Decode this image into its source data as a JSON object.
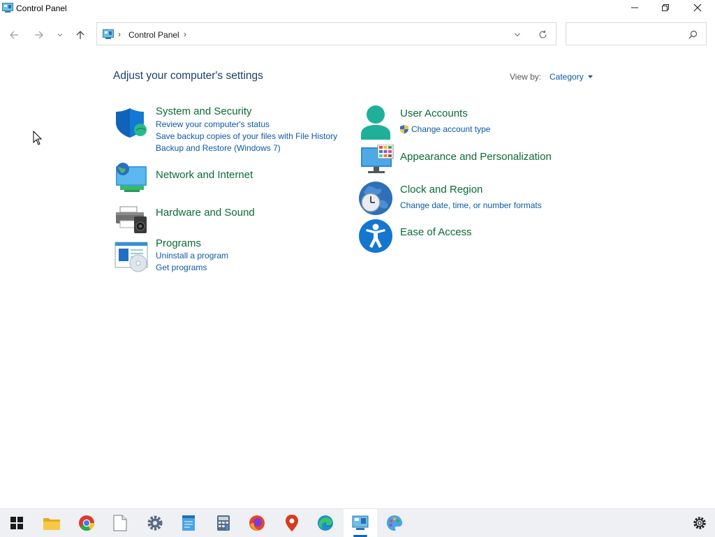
{
  "window": {
    "title": "Control Panel"
  },
  "nav": {
    "breadcrumb": "Control Panel",
    "search_placeholder": ""
  },
  "main": {
    "heading": "Adjust your computer's settings",
    "view_by_label": "View by:",
    "view_by_value": "Category"
  },
  "categories": {
    "system_security": {
      "title": "System and Security",
      "links": [
        "Review your computer's status",
        "Save backup copies of your files with File History",
        "Backup and Restore (Windows 7)"
      ]
    },
    "network": {
      "title": "Network and Internet"
    },
    "hardware": {
      "title": "Hardware and Sound"
    },
    "programs": {
      "title": "Programs",
      "links": [
        "Uninstall a program",
        "Get programs"
      ]
    },
    "user_accounts": {
      "title": "User Accounts",
      "links": [
        "Change account type"
      ]
    },
    "appearance": {
      "title": "Appearance and Personalization"
    },
    "clock_region": {
      "title": "Clock and Region",
      "links": [
        "Change date, time, or number formats"
      ]
    },
    "ease_access": {
      "title": "Ease of Access"
    }
  },
  "taskbar": {
    "items": [
      "start-icon",
      "file-explorer-icon",
      "chrome-icon",
      "file-icon",
      "settings-icon",
      "notepad-icon",
      "calculator-icon",
      "firefox-icon",
      "maps-icon",
      "edge-icon",
      "control-panel-icon",
      "paint-icon"
    ],
    "active": "control-panel-icon"
  },
  "colors": {
    "heading": "#1e3f66",
    "category_title": "#0b6a35",
    "link": "#0b5aa8",
    "taskbar_bg": "#eef0f3",
    "accent": "#0a64c8"
  }
}
